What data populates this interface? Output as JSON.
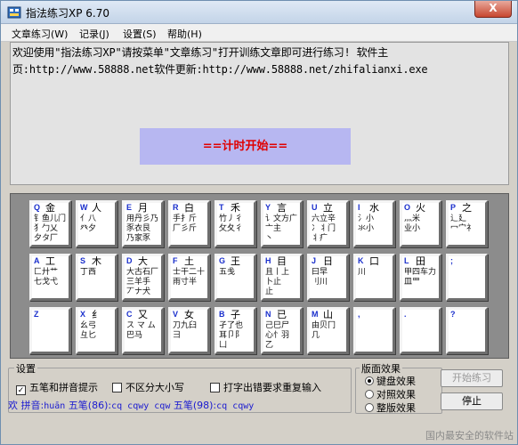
{
  "window": {
    "title": "指法练习XP 6.70",
    "close_label": "X"
  },
  "menu": [
    {
      "label": "文章练习(W)"
    },
    {
      "label": "记录(J)"
    },
    {
      "label": "设置(S)"
    },
    {
      "label": "帮助(H)"
    }
  ],
  "intro_text": "欢迎使用\"指法练习XP\"请按菜单\"文章练习\"打开训练文章即可进行练习! 软件主页:http://www.58888.net软件更新:http://www.58888.net/zhifalianxi.exe",
  "timer_label": "==计时开始==",
  "keyboard": {
    "row1": [
      {
        "letter": "Q",
        "root": "金",
        "radicals": "钅鱼儿门\n犭勹乂\n夕タ厂"
      },
      {
        "letter": "W",
        "root": "人",
        "radicals": "亻八\n癶夕"
      },
      {
        "letter": "E",
        "root": "月",
        "radicals": "用丹彡乃\n豕衣艮\n乃家豕"
      },
      {
        "letter": "R",
        "root": "白",
        "radicals": "手扌斤\n厂彡斤"
      },
      {
        "letter": "T",
        "root": "禾",
        "radicals": "竹丿彳\n攵夂彳"
      },
      {
        "letter": "Y",
        "root": "言",
        "radicals": "讠文方广\n亠主\n丶"
      },
      {
        "letter": "U",
        "root": "立",
        "radicals": "六立辛\n冫丬门\n丬疒"
      },
      {
        "letter": "I",
        "root": "水",
        "radicals": "氵小\n氺小"
      },
      {
        "letter": "O",
        "root": "火",
        "radicals": "灬米\n业小"
      },
      {
        "letter": "P",
        "root": "之",
        "radicals": "辶廴\n冖宀礻"
      }
    ],
    "row2": [
      {
        "letter": "A",
        "root": "工",
        "radicals": "匚廾艹\n七戈弋"
      },
      {
        "letter": "S",
        "root": "木",
        "radicals": "丁西"
      },
      {
        "letter": "D",
        "root": "大",
        "radicals": "大古石厂\n三羊手\n丆ナ犬"
      },
      {
        "letter": "F",
        "root": "土",
        "radicals": "士干二十\n雨寸半"
      },
      {
        "letter": "G",
        "root": "王",
        "radicals": "五戋"
      },
      {
        "letter": "H",
        "root": "目",
        "radicals": "且丨上\n卜止\n止"
      },
      {
        "letter": "J",
        "root": "日",
        "radicals": "曰早\n刂川"
      },
      {
        "letter": "K",
        "root": "口",
        "radicals": "川"
      },
      {
        "letter": "L",
        "root": "田",
        "radicals": "甲四车力\n皿罒"
      },
      {
        "letter": ";",
        "root": "",
        "radicals": ""
      }
    ],
    "row3": [
      {
        "letter": "Z",
        "root": "",
        "radicals": ""
      },
      {
        "letter": "X",
        "root": "纟",
        "radicals": "幺弓\n彑匕"
      },
      {
        "letter": "C",
        "root": "又",
        "radicals": "ス マ ム\n巴马"
      },
      {
        "letter": "V",
        "root": "女",
        "radicals": "刀九臼\n彐"
      },
      {
        "letter": "B",
        "root": "子",
        "radicals": "孑了也\n耳卩阝\n凵"
      },
      {
        "letter": "N",
        "root": "已",
        "radicals": "己巳尸\n心忄羽\n乙"
      },
      {
        "letter": "M",
        "root": "山",
        "radicals": "由贝冂\n几"
      },
      {
        "letter": ",",
        "root": "",
        "radicals": ""
      },
      {
        "letter": ".",
        "root": "",
        "radicals": ""
      },
      {
        "letter": "?",
        "root": "",
        "radicals": ""
      }
    ]
  },
  "settings": {
    "title": "设置",
    "wubi_pinyin_hint": "五笔和拼音提示",
    "wubi_pinyin_checked": true,
    "case_insensitive": "不区分大小写",
    "case_insensitive_checked": false,
    "repeat_on_error": "打字出错要求重复输入",
    "repeat_on_error_checked": false,
    "status_char": "欢",
    "status_pinyin_label": "拼音:",
    "status_pinyin_value": "huān",
    "status_wubi86_label": "五笔(86):",
    "status_wubi86_value": "cq cqwy cqw",
    "status_wubi98_label": "五笔(98):",
    "status_wubi98_value": "cq cqwy"
  },
  "effects": {
    "title": "版面效果",
    "options": [
      {
        "label": "键盘效果",
        "selected": true
      },
      {
        "label": "对照效果",
        "selected": false
      },
      {
        "label": "整版效果",
        "selected": false
      }
    ]
  },
  "buttons": {
    "start": "开始练习",
    "stop": "停止"
  },
  "watermark": "国内最安全的软件站"
}
